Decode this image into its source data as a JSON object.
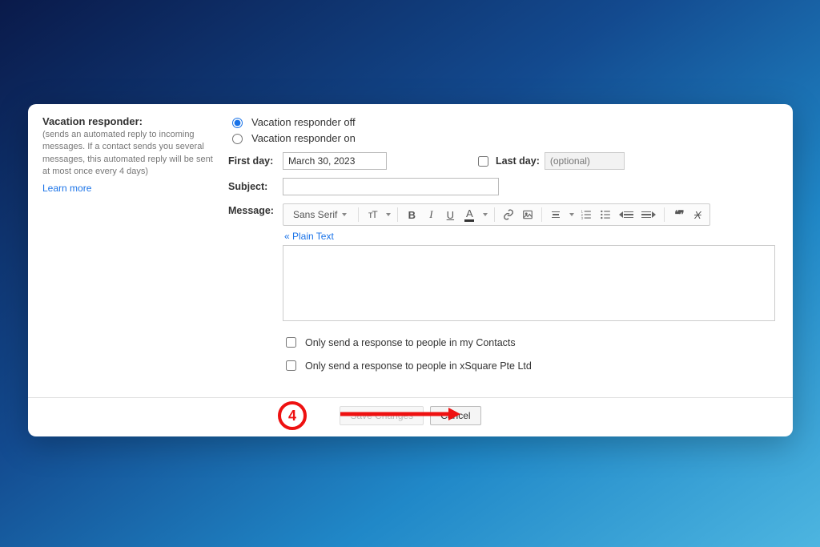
{
  "left": {
    "title": "Vacation responder:",
    "help": "(sends an automated reply to incoming messages. If a contact sends you several messages, this automated reply will be sent at most once every 4 days)",
    "learn": "Learn more"
  },
  "radios": {
    "off": "Vacation responder off",
    "on": "Vacation responder on"
  },
  "fields": {
    "first_day_label": "First day:",
    "first_day_value": "March 30, 2023",
    "last_day_label": "Last day:",
    "last_day_placeholder": "(optional)",
    "subject_label": "Subject:",
    "message_label": "Message:"
  },
  "toolbar": {
    "font_name": "Sans Serif",
    "size_glyph": "тT",
    "bold": "B",
    "italic": "I",
    "underline": "U",
    "color_a": "A",
    "quote": "❝❞",
    "strike": "X",
    "plain_text": "« Plain Text"
  },
  "checkboxes": {
    "contacts": "Only send a response to people in my Contacts",
    "domain": "Only send a response to people in xSquare Pte Ltd"
  },
  "footer": {
    "save": "Save Changes",
    "cancel": "Cancel"
  },
  "annotation": {
    "number": "4"
  }
}
